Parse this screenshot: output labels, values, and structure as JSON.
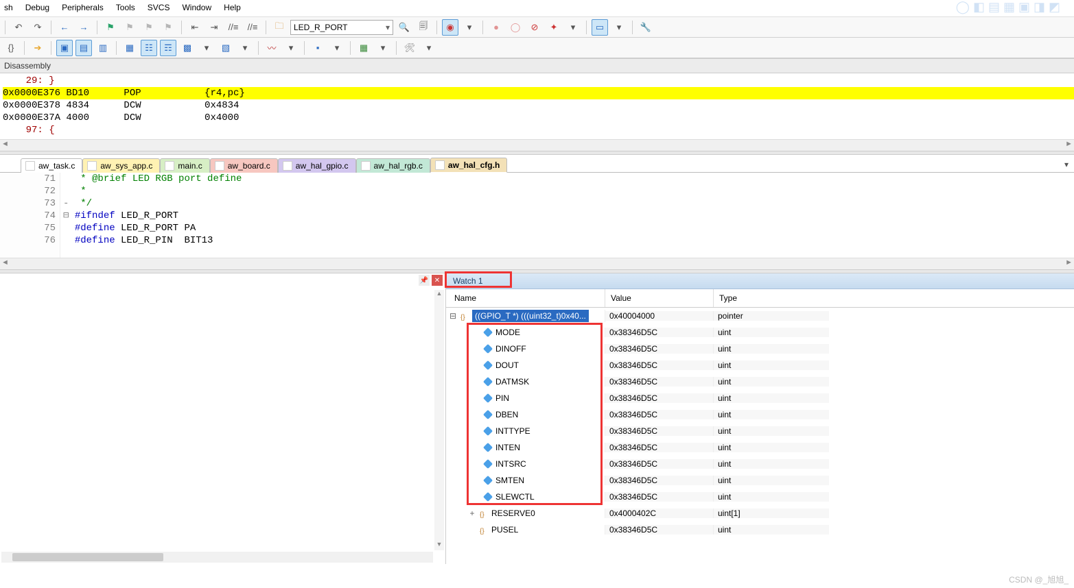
{
  "menu": [
    "sh",
    "Debug",
    "Peripherals",
    "Tools",
    "SVCS",
    "Window",
    "Help"
  ],
  "toolbar1": {
    "combo_value": "LED_R_PORT"
  },
  "panels": {
    "disasm_title": "Disassembly",
    "disasm_lines": [
      {
        "text": "    29: }",
        "cls": "ln-red"
      },
      {
        "text": "0x0000E376 BD10      POP           {r4,pc}",
        "cls": "hl"
      },
      {
        "text": "0x0000E378 4834      DCW           0x4834",
        "cls": ""
      },
      {
        "text": "0x0000E37A 4000      DCW           0x4000",
        "cls": ""
      },
      {
        "text": "    97: {",
        "cls": "ln-red"
      }
    ]
  },
  "file_tabs": [
    {
      "label": "aw_task.c",
      "bg": "#ffffff",
      "active": false
    },
    {
      "label": "aw_sys_app.c",
      "bg": "#fff2b3",
      "active": false
    },
    {
      "label": "main.c",
      "bg": "#d7efc5",
      "active": false
    },
    {
      "label": "aw_board.c",
      "bg": "#f7c7c0",
      "active": false
    },
    {
      "label": "aw_hal_gpio.c",
      "bg": "#d3c7ef",
      "active": false
    },
    {
      "label": "aw_hal_rgb.c",
      "bg": "#c2e8d6",
      "active": false
    },
    {
      "label": "aw_hal_cfg.h",
      "bg": "#f3e1b7",
      "active": true
    }
  ],
  "code": {
    "start": 71,
    "lines": [
      {
        "n": 71,
        "pre": "  ",
        "html": "<span class='cm-comment'> * @brief LED RGB port define</span>"
      },
      {
        "n": 72,
        "pre": "  ",
        "html": "<span class='cm-comment'> *</span>"
      },
      {
        "n": 73,
        "pre": "- ",
        "html": "<span class='cm-comment'> */</span>"
      },
      {
        "n": 74,
        "pre": "⊟ ",
        "html": "<span class='cm-macro'>#ifndef</span><span class='cm-plain'> LED_R_PORT</span>"
      },
      {
        "n": 75,
        "pre": "  ",
        "html": "<span class='cm-macro'>#define</span><span class='cm-plain'> LED_R_PORT PA</span>"
      },
      {
        "n": 76,
        "pre": "  ",
        "html": "<span class='cm-macro'>#define</span><span class='cm-plain'> LED_R_PIN  BIT13</span>"
      }
    ]
  },
  "watch": {
    "title": "Watch 1",
    "head_name": "Name",
    "head_value": "Value",
    "head_type": "Type",
    "root": {
      "name": "((GPIO_T *) (((uint32_t)0x40...",
      "value": "0x40004000",
      "type": "pointer"
    },
    "fields": [
      {
        "name": "MODE",
        "value": "0x38346D5C",
        "type": "uint"
      },
      {
        "name": "DINOFF",
        "value": "0x38346D5C",
        "type": "uint"
      },
      {
        "name": "DOUT",
        "value": "0x38346D5C",
        "type": "uint"
      },
      {
        "name": "DATMSK",
        "value": "0x38346D5C",
        "type": "uint"
      },
      {
        "name": "PIN",
        "value": "0x38346D5C",
        "type": "uint"
      },
      {
        "name": "DBEN",
        "value": "0x38346D5C",
        "type": "uint"
      },
      {
        "name": "INTTYPE",
        "value": "0x38346D5C",
        "type": "uint"
      },
      {
        "name": "INTEN",
        "value": "0x38346D5C",
        "type": "uint"
      },
      {
        "name": "INTSRC",
        "value": "0x38346D5C",
        "type": "uint"
      },
      {
        "name": "SMTEN",
        "value": "0x38346D5C",
        "type": "uint"
      },
      {
        "name": "SLEWCTL",
        "value": "0x38346D5C",
        "type": "uint"
      }
    ],
    "tail": [
      {
        "name": "RESERVE0",
        "value": "0x4000402C",
        "type": "uint[1]",
        "expand": "+"
      },
      {
        "name": "PUSEL",
        "value": "0x38346D5C",
        "type": "uint",
        "expand": ""
      }
    ]
  },
  "watermark": "CSDN @_旭旭_"
}
